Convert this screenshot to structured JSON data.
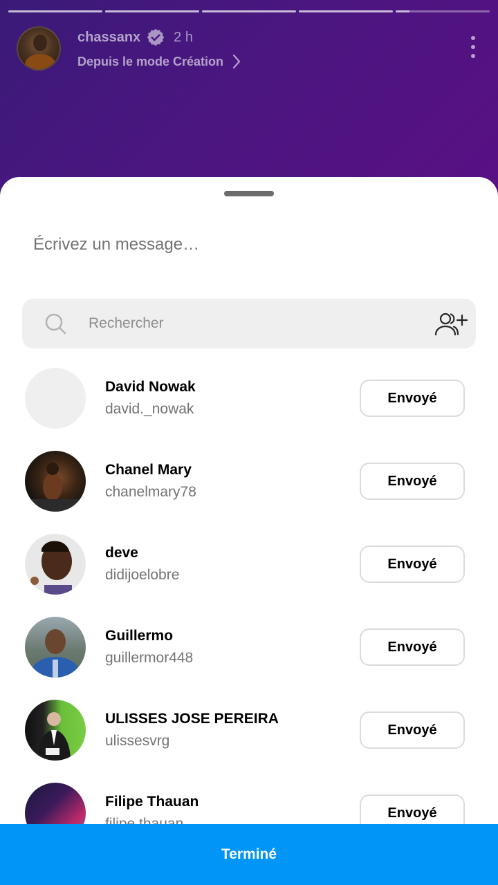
{
  "story": {
    "username": "chassanx",
    "time": "2 h",
    "subtitle": "Depuis le mode Création",
    "progress": [
      1,
      1,
      1,
      1,
      0.15
    ],
    "background_colors": [
      "#3a1a78",
      "#5a0f84"
    ]
  },
  "share_sheet": {
    "message_placeholder": "Écrivez un message…",
    "search_placeholder": "Rechercher",
    "icons": {
      "search": "search-icon",
      "add_people": "add-people-icon",
      "verified": "verified-badge-icon",
      "more": "more-vertical-icon"
    },
    "recipients": [
      {
        "name": "David Nowak",
        "username": "david._nowak",
        "button": "Envoyé",
        "avatar": "empty"
      },
      {
        "name": "Chanel Mary",
        "username": "chanelmary78",
        "button": "Envoyé",
        "avatar": "photo"
      },
      {
        "name": "deve",
        "username": "didijoelobre",
        "button": "Envoyé",
        "avatar": "photo"
      },
      {
        "name": "Guillermo",
        "username": "guillermor448",
        "button": "Envoyé",
        "avatar": "photo"
      },
      {
        "name": "ULISSES JOSE PEREIRA",
        "username": "ulissesvrg",
        "button": "Envoyé",
        "avatar": "photo"
      },
      {
        "name": "Filipe Thauan",
        "username": "filipe.thauan",
        "button": "Envoyé",
        "avatar": "photo"
      }
    ],
    "done_label": "Terminé",
    "accent_color": "#0095f6"
  }
}
